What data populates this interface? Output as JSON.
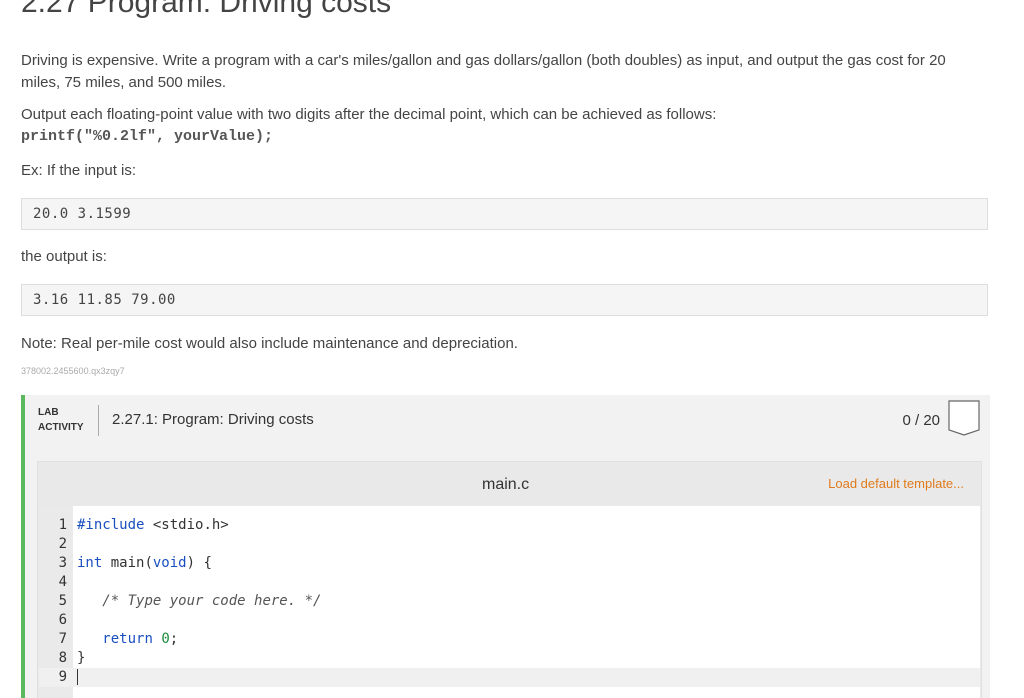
{
  "page": {
    "title": "2.27 Program: Driving costs",
    "description": "Driving is expensive. Write a program with a car's miles/gallon and gas dollars/gallon (both doubles) as input, and output the gas cost for 20 miles, 75 miles, and 500 miles.",
    "format_text": "Output each floating-point value with two digits after the decimal point, which can be achieved as follows:",
    "format_code": "printf(\"%0.2lf\", yourValue);",
    "example_label": "Ex: If the input is:",
    "example_input": "20.0 3.1599",
    "output_label": "the output is:",
    "example_output": "3.16 11.85 79.00",
    "note": "Note: Real per-mile cost would also include maintenance and depreciation.",
    "meta_id": "378002.2455600.qx3zqy7"
  },
  "lab": {
    "tag_line1": "LAB",
    "tag_line2": "ACTIVITY",
    "title": "2.27.1: Program: Driving costs",
    "score": "0 / 20",
    "file_tab": "main.c",
    "load_template": "Load default template...",
    "accent_color": "#5cb85c",
    "code_lines": [
      {
        "num": "1",
        "parts": [
          {
            "t": "#include",
            "c": "kw"
          },
          {
            "t": " <stdio.h>",
            "c": ""
          }
        ]
      },
      {
        "num": "2",
        "parts": []
      },
      {
        "num": "3",
        "parts": [
          {
            "t": "int",
            "c": "kw"
          },
          {
            "t": " main(",
            "c": ""
          },
          {
            "t": "void",
            "c": "kw"
          },
          {
            "t": ") {",
            "c": ""
          }
        ]
      },
      {
        "num": "4",
        "parts": []
      },
      {
        "num": "5",
        "parts": [
          {
            "t": "   ",
            "c": ""
          },
          {
            "t": "/* Type your code here. */",
            "c": "cm"
          }
        ]
      },
      {
        "num": "6",
        "parts": []
      },
      {
        "num": "7",
        "parts": [
          {
            "t": "   ",
            "c": ""
          },
          {
            "t": "return",
            "c": "kw"
          },
          {
            "t": " ",
            "c": ""
          },
          {
            "t": "0",
            "c": "nm"
          },
          {
            "t": ";",
            "c": ""
          }
        ]
      },
      {
        "num": "8",
        "parts": [
          {
            "t": "}",
            "c": ""
          }
        ]
      },
      {
        "num": "9",
        "parts": [],
        "active": true,
        "cursor": true
      }
    ]
  }
}
